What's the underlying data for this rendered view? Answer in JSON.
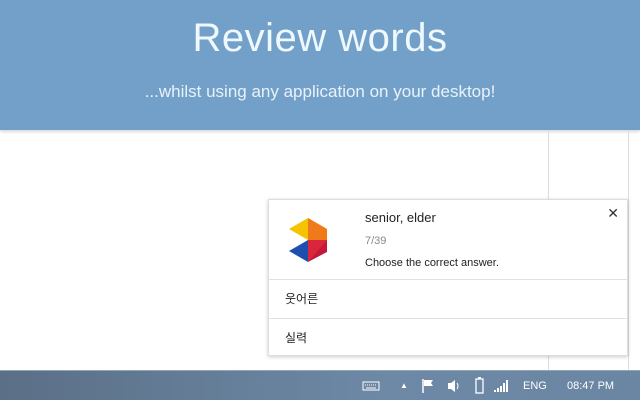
{
  "banner": {
    "title": "Review words",
    "subtitle": "...whilst using any application on your desktop!"
  },
  "notification": {
    "word": "senior, elder",
    "progress": "7/39",
    "instruction": "Choose the correct answer.",
    "options": [
      "웃어른",
      "실력"
    ],
    "close_icon": "close-icon"
  },
  "taskbar": {
    "language": "ENG",
    "time": "08:47 PM"
  }
}
